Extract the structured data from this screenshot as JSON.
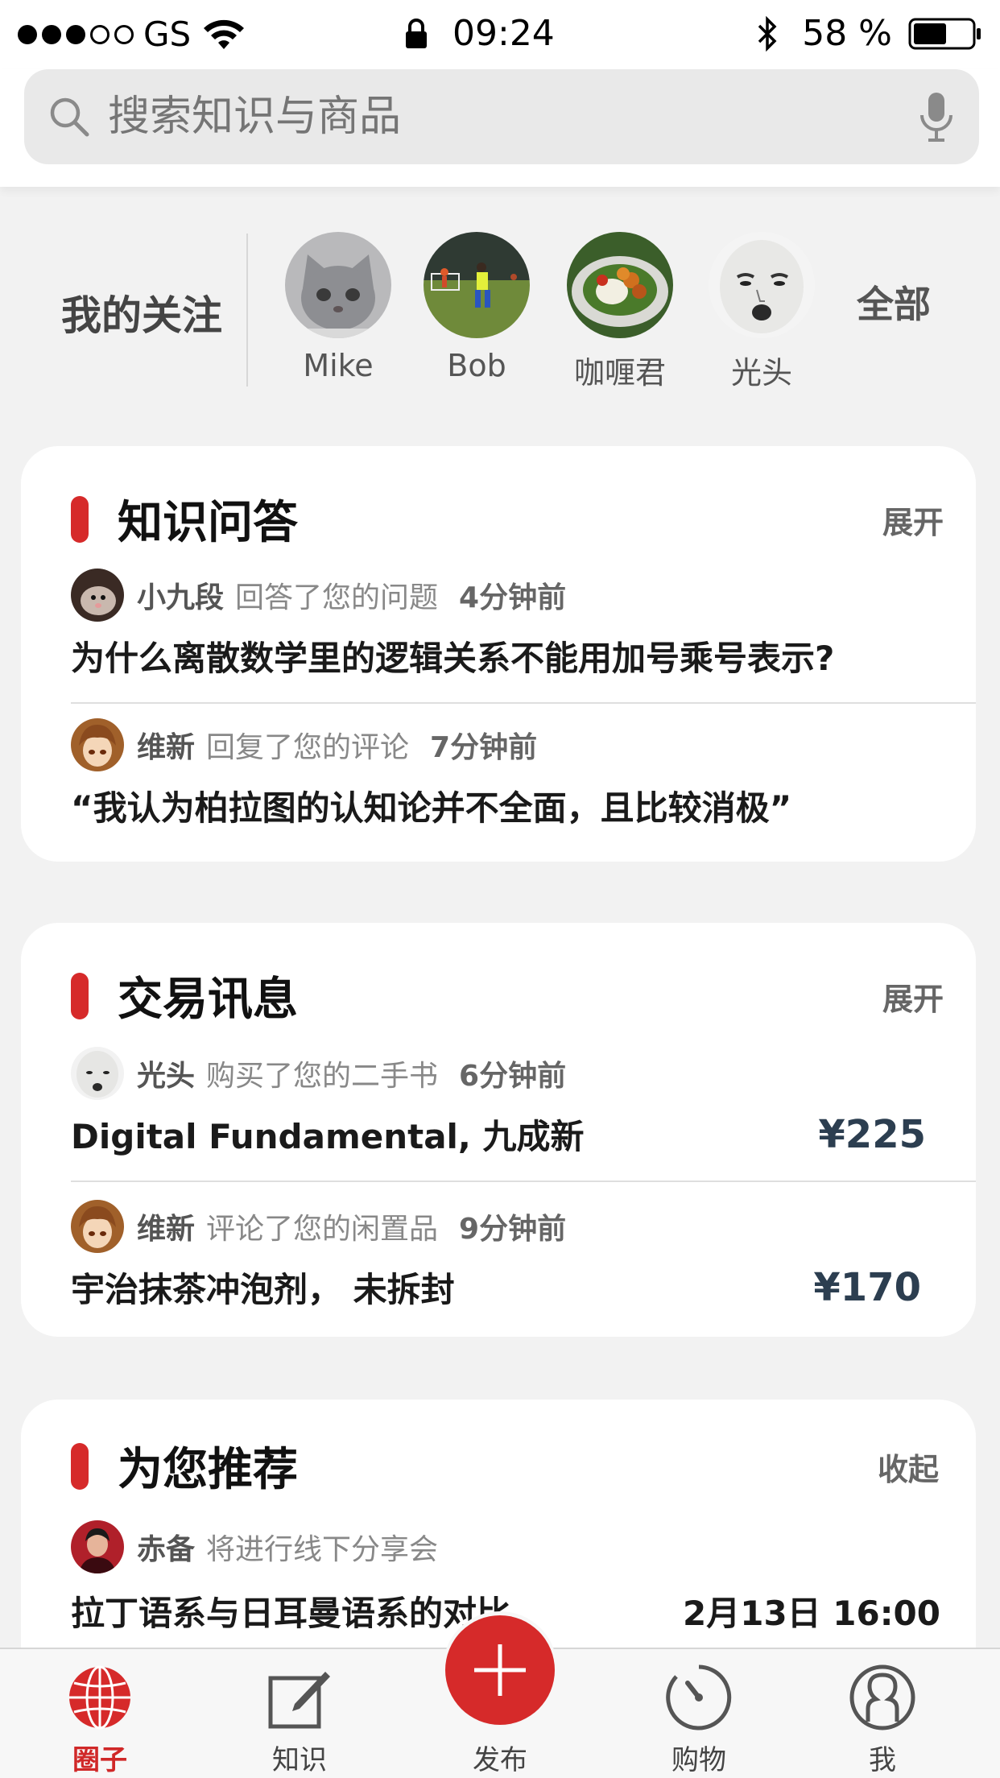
{
  "status_bar": {
    "carrier": "GS",
    "time": "09:24",
    "battery": "58 %"
  },
  "search": {
    "placeholder": "搜索知识与商品"
  },
  "following": {
    "title": "我的关注",
    "all_label": "全部",
    "users": [
      {
        "name": "Mike",
        "avatar": "grey-cat-avatar"
      },
      {
        "name": "Bob",
        "avatar": "soccer-field-avatar"
      },
      {
        "name": "咖喱君",
        "avatar": "curry-dish-avatar"
      },
      {
        "name": "光头",
        "avatar": "bald-face-meme-avatar"
      }
    ]
  },
  "qa_card": {
    "title": "知识问答",
    "toggle": "展开",
    "items": [
      {
        "user": "小九段",
        "action": "回答了您的问题",
        "time": "4分钟前",
        "content": "为什么离散数学里的逻辑关系不能用加号乘号表示?"
      },
      {
        "user": "维新",
        "action": "回复了您的评论",
        "time": "7分钟前",
        "content": "“我认为柏拉图的认知论并不全面，且比较消极”"
      }
    ]
  },
  "trade_card": {
    "title": "交易讯息",
    "toggle": "展开",
    "items": [
      {
        "user": "光头",
        "action": "购买了您的二手书",
        "time": "6分钟前",
        "content": "Digital Fundamental, 九成新",
        "price": "¥225"
      },
      {
        "user": "维新",
        "action": "评论了您的闲置品",
        "time": "9分钟前",
        "content": "宇治抹茶冲泡剂， 未拆封",
        "price": "¥170"
      }
    ]
  },
  "recommend_card": {
    "title": "为您推荐",
    "toggle": "收起",
    "items": [
      {
        "user": "赤备",
        "action": "将进行线下分享会",
        "content": "拉丁语系与日耳曼语系的对比",
        "date": "2月13日 16:00"
      }
    ]
  },
  "tab_bar": {
    "tabs": [
      {
        "label": "圈子",
        "icon": "globe-icon",
        "active": true
      },
      {
        "label": "知识",
        "icon": "edit-note-icon"
      },
      {
        "label": "发布",
        "icon": "plus-icon"
      },
      {
        "label": "购物",
        "icon": "timer-icon"
      },
      {
        "label": "我",
        "icon": "user-icon"
      }
    ]
  },
  "colors": {
    "accent": "#d62a2a",
    "background": "#f2f2f2",
    "card": "#ffffff"
  }
}
